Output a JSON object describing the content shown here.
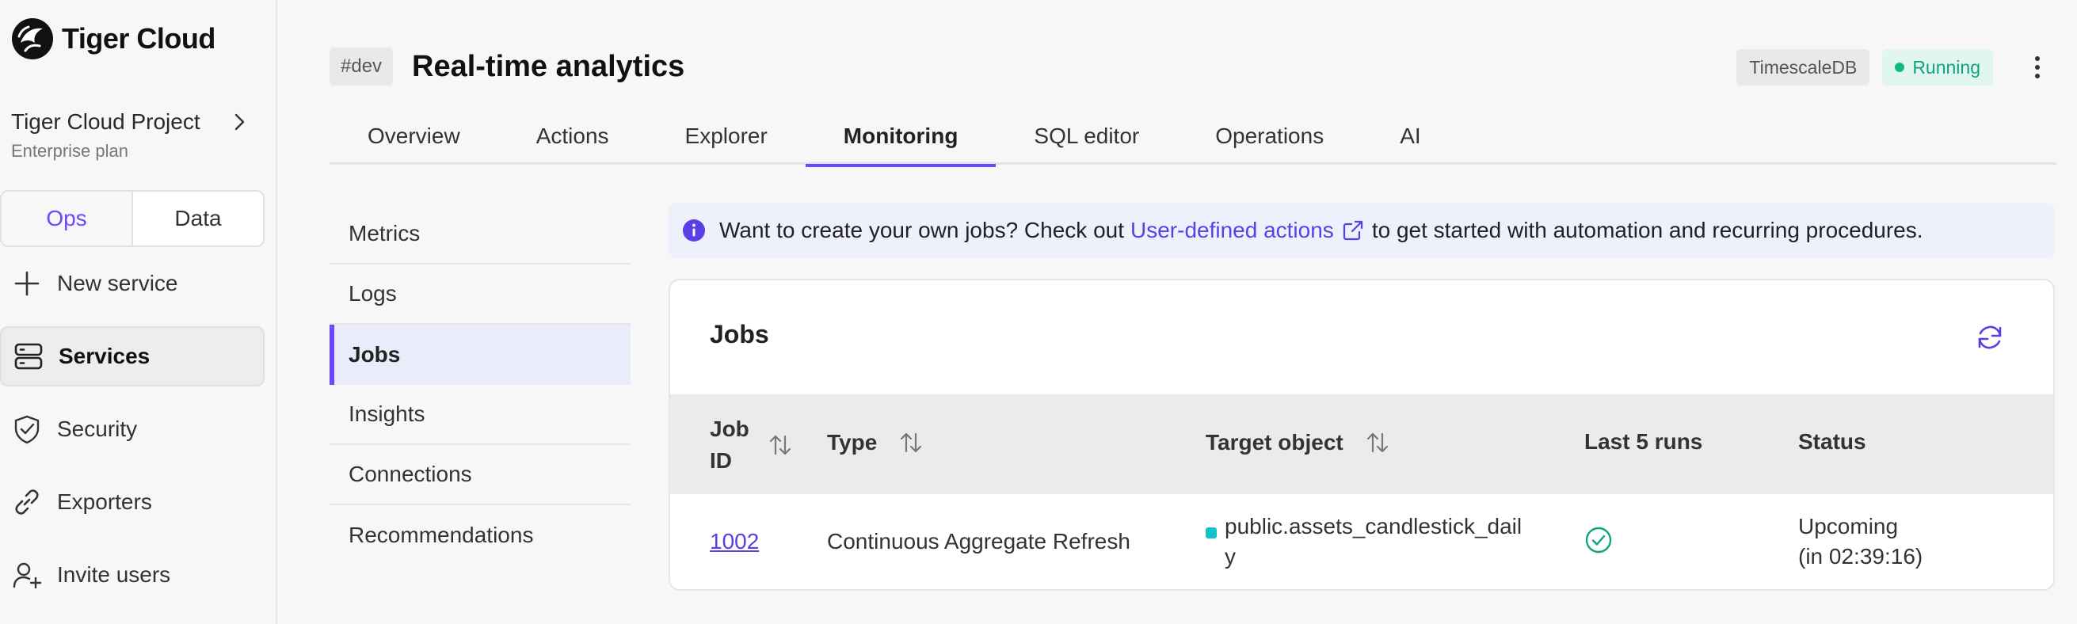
{
  "brand": {
    "name": "Tiger Cloud"
  },
  "project": {
    "name": "Tiger Cloud Project",
    "plan": "Enterprise plan"
  },
  "mode_toggle": {
    "ops": "Ops",
    "data": "Data"
  },
  "sidebar": {
    "items": [
      {
        "label": "New service",
        "icon": "plus-icon"
      },
      {
        "label": "Services",
        "icon": "services-icon"
      },
      {
        "label": "Security",
        "icon": "shield-check-icon"
      },
      {
        "label": "Exporters",
        "icon": "link-icon"
      },
      {
        "label": "Invite users",
        "icon": "user-plus-icon"
      }
    ]
  },
  "header": {
    "tag": "#dev",
    "title": "Real-time analytics",
    "db_badge": "TimescaleDB",
    "status": "Running"
  },
  "tabs": [
    "Overview",
    "Actions",
    "Explorer",
    "Monitoring",
    "SQL editor",
    "Operations",
    "AI"
  ],
  "subnav": [
    "Metrics",
    "Logs",
    "Jobs",
    "Insights",
    "Connections",
    "Recommendations"
  ],
  "banner": {
    "before": "Want to create your own jobs? Check out",
    "link": "User-defined actions",
    "after": "to get started with automation and recurring procedures."
  },
  "jobs": {
    "title": "Jobs",
    "columns": {
      "job_id_line1": "Job",
      "job_id_line2": "ID",
      "type": "Type",
      "target": "Target object",
      "last_runs": "Last 5 runs",
      "status": "Status"
    },
    "rows": [
      {
        "id": "1002",
        "type": "Continuous Aggregate Refresh",
        "target_line1": "public.assets_candlestick_dail",
        "target_line2": "y",
        "status_line1": "Upcoming",
        "status_line2": "(in 02:39:16)"
      }
    ]
  },
  "colors": {
    "accent": "#6c47ff",
    "running": "#10a37f",
    "target_dot": "#14c4c4"
  }
}
